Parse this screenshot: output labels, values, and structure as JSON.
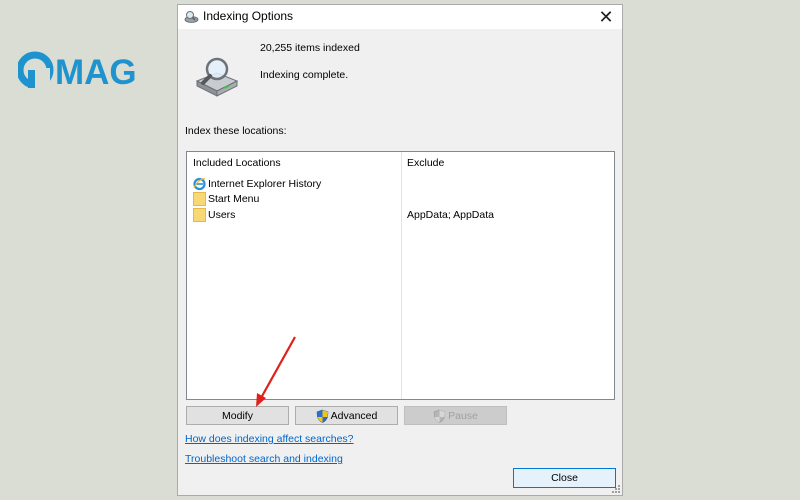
{
  "brand": {
    "logo_text": "MAG",
    "logo_color": "#1e93ce"
  },
  "dialog": {
    "title": "Indexing Options",
    "close_glyph": "✕",
    "items_indexed": "20,255 items indexed",
    "status": "Indexing complete.",
    "section_label": "Index these locations:",
    "table": {
      "headers": {
        "included": "Included Locations",
        "exclude": "Exclude"
      },
      "rows": [
        {
          "name": "Internet Explorer History",
          "exclude": "",
          "icon": "ie-icon"
        },
        {
          "name": "Start Menu",
          "exclude": "",
          "icon": "folder-icon"
        },
        {
          "name": "Users",
          "exclude": "AppData; AppData",
          "icon": "folder-icon"
        }
      ]
    },
    "buttons": {
      "modify": "Modify",
      "advanced": "Advanced",
      "pause": "Pause",
      "close": "Close"
    },
    "links": {
      "how_affects": "How does indexing affect searches?",
      "troubleshoot": "Troubleshoot search and indexing"
    }
  },
  "annotation": {
    "arrow_color": "#e0201b"
  }
}
